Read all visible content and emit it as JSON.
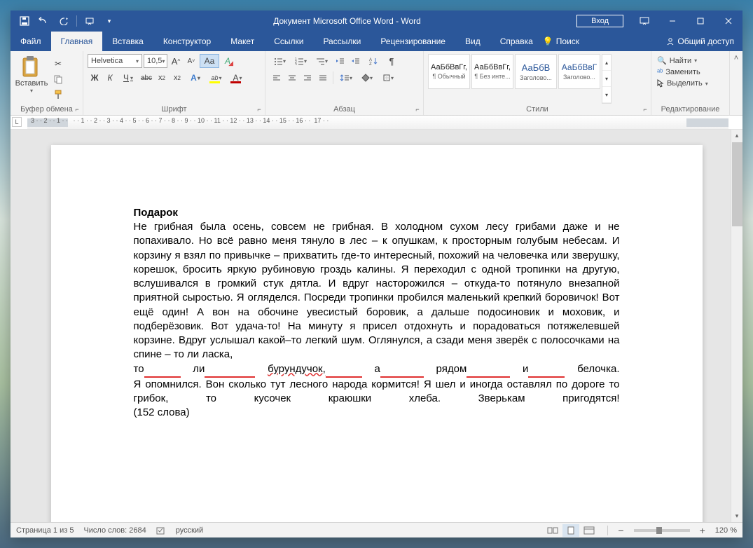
{
  "titlebar": {
    "title": "Документ Microsoft Office Word  -  Word",
    "login": "Вход"
  },
  "menu": {
    "file": "Файл",
    "home": "Главная",
    "insert": "Вставка",
    "design": "Конструктор",
    "layout": "Макет",
    "references": "Ссылки",
    "mailings": "Рассылки",
    "review": "Рецензирование",
    "view": "Вид",
    "help": "Справка",
    "tellme": "Поиск",
    "share": "Общий доступ"
  },
  "ribbon": {
    "clipboard": {
      "paste": "Вставить",
      "label": "Буфер обмена"
    },
    "font": {
      "name": "Helvetica",
      "size": "10,5",
      "label": "Шрифт",
      "bold": "Ж",
      "italic": "К",
      "underline": "Ч",
      "strike": "abc",
      "sub": "x₂",
      "sup": "x²",
      "grow": "A",
      "shrink": "A",
      "case": "Aa",
      "clear": "A",
      "effects": "A",
      "highlight": "abc",
      "fontcolor": "A"
    },
    "paragraph": {
      "label": "Абзац"
    },
    "styles": {
      "label": "Стили",
      "items": [
        {
          "sample": "АаБбВвГг,",
          "name": "¶ Обычный"
        },
        {
          "sample": "АаБбВвГг,",
          "name": "¶ Без инте..."
        },
        {
          "sample": "АаБбВ",
          "name": "Заголово..."
        },
        {
          "sample": "АаБбВвГ",
          "name": "Заголово..."
        }
      ]
    },
    "editing": {
      "find": "Найти",
      "replace": "Заменить",
      "select": "Выделить",
      "label": "Редактирование"
    }
  },
  "document": {
    "title": "Подарок",
    "body_p1": "Не грибная была осень, совсем не грибная. В холодном сухом лесу грибами даже и не попахивало. Но всё равно меня тянуло в лес – к опушкам, к просторным голубым небесам. И корзину я взял по привычке – прихватить где-то интересный, похожий на человечка или зверушку, корешок, бросить яркую рубиновую гроздь калины. Я переходил с одной тропинки на другую, вслушивался в громкий стук дятла. И вдруг насторожился – откуда-то потянуло внезапной приятной сыростью. Я огляделся. Посреди тропинки пробился маленький крепкий боровичок! Вот ещё один! А вон на обочине увесистый боровик, а дальше подосиновик и моховик, и подберёзовик. Вот удача-то! На минуту я присел отдохнуть и порадоваться потяжелевшей корзине. Вдруг услышал какой–то легкий шум. Оглянулся, а сзади меня зверёк с полосочками на спине – то ли ласка, ",
    "line_to": "то",
    "line_li": "ли",
    "line_bur": "бурундучок,",
    "line_a": "а",
    "line_ryadom": "рядом",
    "line_i": "и",
    "line_bel": "белочка.",
    "body_p2a": "Я опомнился. Вон сколько тут лесного народа кормится! Я шел и иногда оставлял по дороге то грибок, то кусочек краюшки хлеба. Зверькам пригодятся!",
    "body_p2b": "(152 слова)"
  },
  "statusbar": {
    "page": "Страница 1 из 5",
    "words": "Число слов: 2684",
    "lang": "русский",
    "zoom": "120 %"
  }
}
